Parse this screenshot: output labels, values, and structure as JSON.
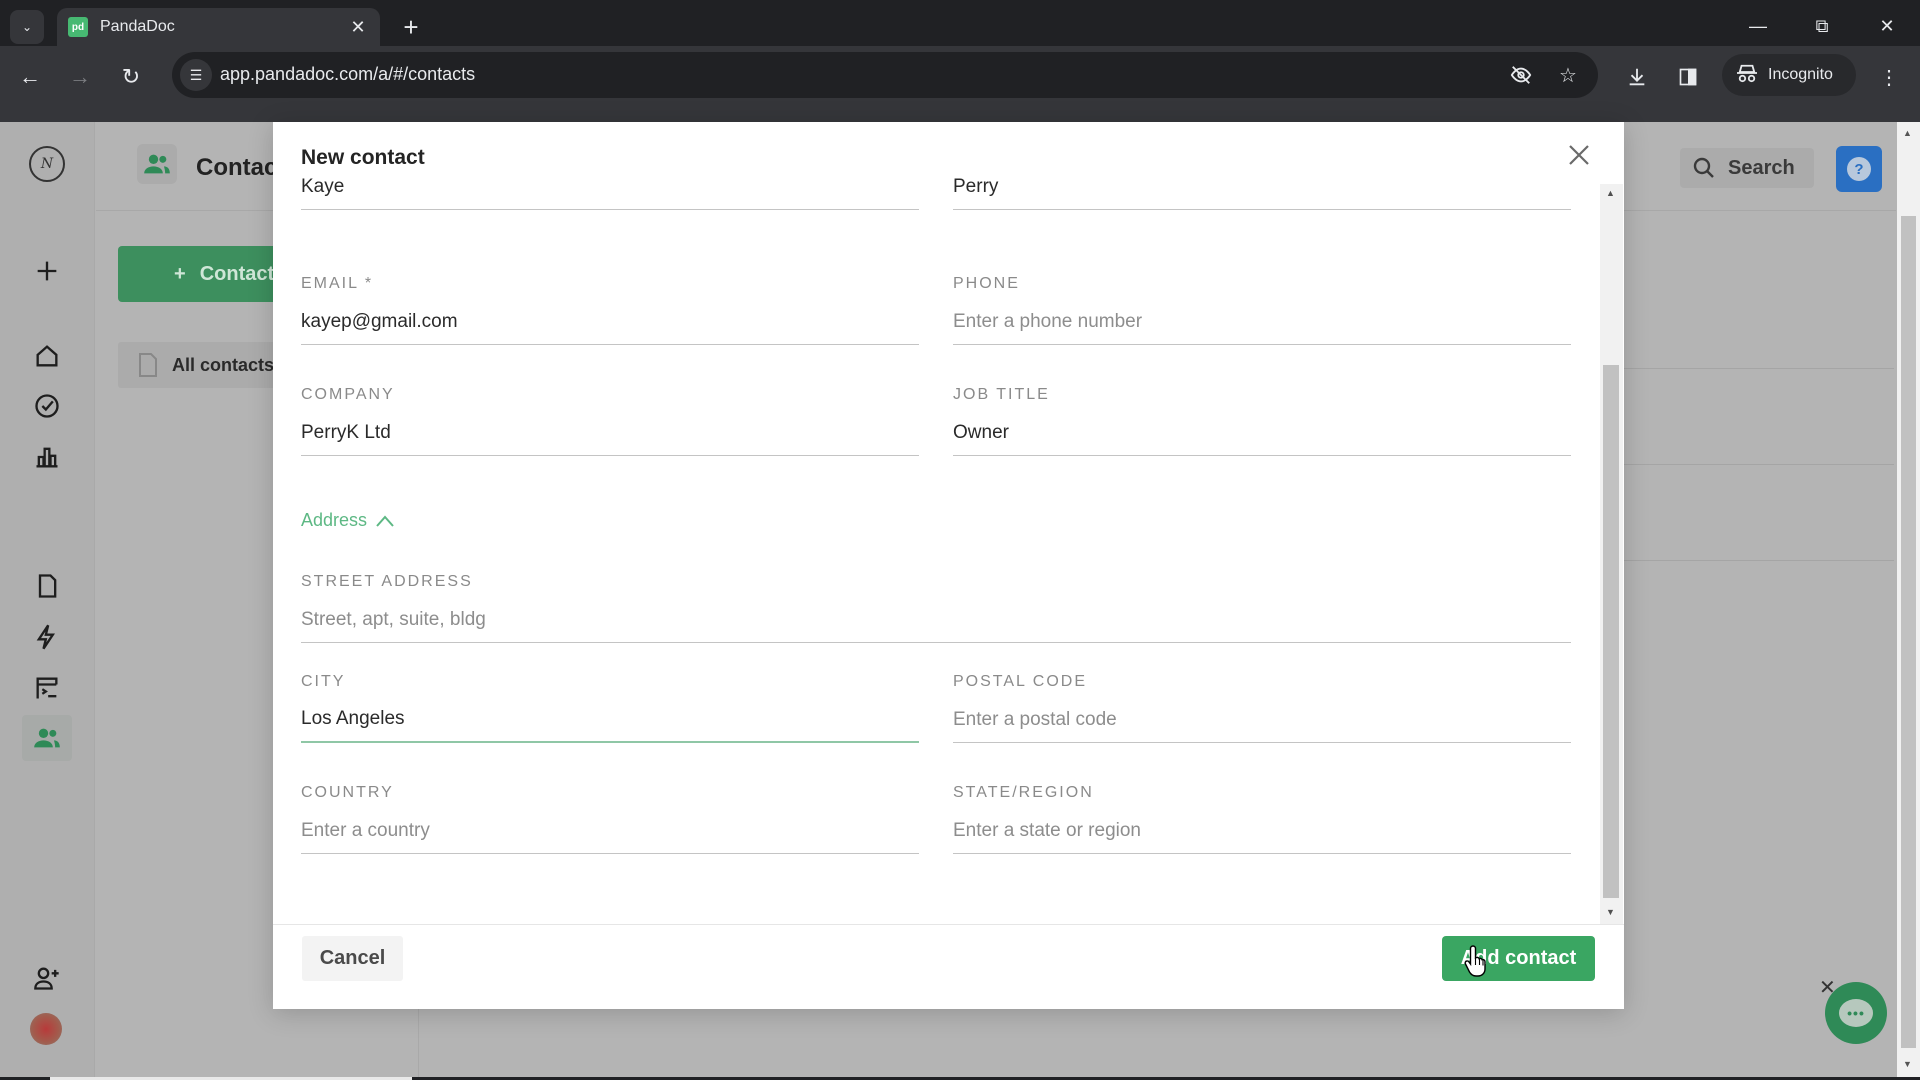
{
  "browser": {
    "tab_title": "PandaDoc",
    "tab_favicon_text": "pd",
    "url": "app.pandadoc.com/a/#/contacts",
    "incognito_label": "Incognito"
  },
  "app": {
    "page_title": "Contacts",
    "add_contact_bg_label": "Contact",
    "all_contacts_label": "All contacts",
    "search_label": "Search",
    "help_label": "?",
    "logo_text": "N",
    "chat_dots": "•••"
  },
  "modal": {
    "title": "New contact",
    "fields": {
      "first_name": {
        "label": "",
        "value": "Kaye",
        "placeholder": ""
      },
      "last_name": {
        "label": "",
        "value": "Perry",
        "placeholder": ""
      },
      "email": {
        "label": "EMAIL *",
        "value": "kayep@gmail.com",
        "placeholder": ""
      },
      "phone": {
        "label": "PHONE",
        "value": "",
        "placeholder": "Enter a phone number"
      },
      "company": {
        "label": "COMPANY",
        "value": "PerryK Ltd",
        "placeholder": ""
      },
      "job_title": {
        "label": "JOB TITLE",
        "value": "Owner",
        "placeholder": ""
      },
      "street": {
        "label": "STREET ADDRESS",
        "value": "",
        "placeholder": "Street, apt, suite, bldg"
      },
      "city": {
        "label": "CITY",
        "value": "Los Angeles",
        "placeholder": ""
      },
      "postal": {
        "label": "POSTAL CODE",
        "value": "",
        "placeholder": "Enter a postal code"
      },
      "country": {
        "label": "COUNTRY",
        "value": "",
        "placeholder": "Enter a country"
      },
      "state": {
        "label": "STATE/REGION",
        "value": "",
        "placeholder": "Enter a state or region"
      }
    },
    "address_toggle_label": "Address",
    "address_expanded": true,
    "cancel_label": "Cancel",
    "submit_label": "Add contact"
  },
  "colors": {
    "brand_green": "#3aa662",
    "address_link": "#5db884",
    "help_blue": "#2a6fc2"
  }
}
